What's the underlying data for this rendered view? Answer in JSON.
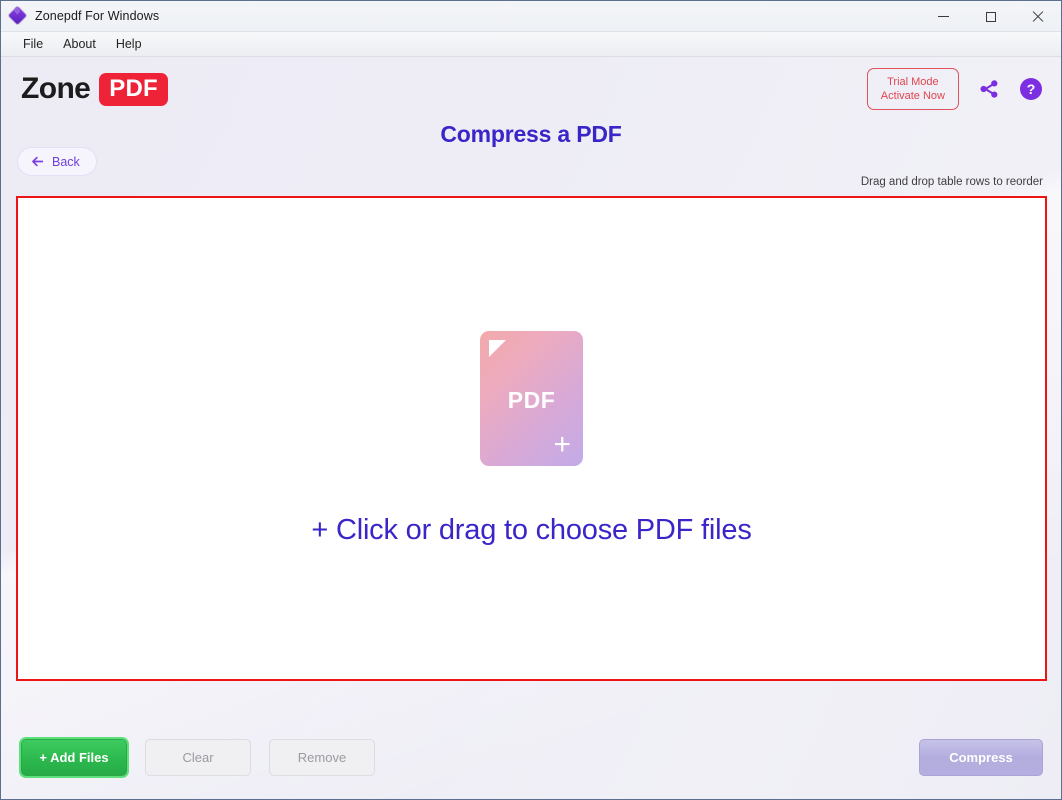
{
  "window": {
    "title": "Zonepdf For Windows",
    "app_icon": "zonepdf-diamond-icon",
    "controls": {
      "minimize": "minimize-icon",
      "maximize": "maximize-icon",
      "close": "close-icon"
    }
  },
  "menubar": {
    "items": [
      {
        "label": "File"
      },
      {
        "label": "About"
      },
      {
        "label": "Help"
      }
    ]
  },
  "header": {
    "logo": {
      "word_mark": "Zone",
      "badge": "PDF",
      "badge_color": "#ee2338"
    },
    "trial": {
      "line1": "Trial Mode",
      "line2": "Activate Now",
      "color": "#e0454f"
    },
    "share_icon": "share-icon",
    "help_icon": "help-circle-icon",
    "accent_color": "#7b2fe0"
  },
  "page": {
    "title": "Compress a PDF",
    "title_color": "#3a25c8",
    "back_label": "Back",
    "back_icon": "arrow-left-icon",
    "reorder_hint": "Drag and drop table rows to reorder"
  },
  "dropzone": {
    "border_color": "#ec1414",
    "card": {
      "label": "PDF",
      "plus": "+",
      "gradient_from": "#f2a9ab",
      "gradient_to": "#c2aae8"
    },
    "prompt": "+ Click or drag to choose PDF files"
  },
  "actions": {
    "add_files": "+ Add Files",
    "clear": "Clear",
    "remove": "Remove",
    "compress": "Compress"
  }
}
